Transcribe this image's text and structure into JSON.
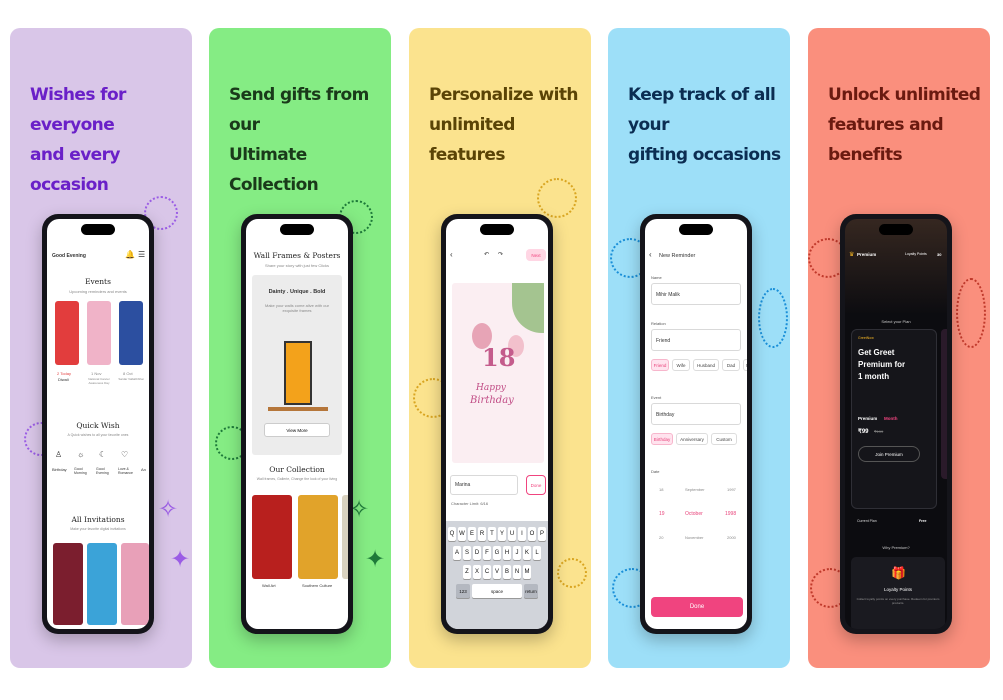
{
  "colors": {
    "card1": "#d9c6e8",
    "card2": "#85ec84",
    "card3": "#fbe38e",
    "card4": "#9ddff8",
    "card5": "#fa8f7d",
    "accent_pink": "#f0447f",
    "premium_gold": "#f5b625"
  },
  "cards": [
    {
      "headline_1": "Wishes for everyone",
      "headline_2": "and every occasion",
      "screen": {
        "greeting": "Good Evening",
        "events_title": "Events",
        "events_sub": "Upcoming reminders and events",
        "event_tiles": [
          {
            "when": "2 Today",
            "name": "Diwali"
          },
          {
            "when": "1 Nov",
            "name": "National Cancer Awareness Day"
          },
          {
            "when": "8 Oct",
            "name": "Sardar Vallabhbhai"
          }
        ],
        "quick_wish_title": "Quick Wish",
        "quick_wish_sub": "A Quick wishes to all your favorite ones",
        "quick_items": [
          "Birthday",
          "Good Morning",
          "Good Evening",
          "Love & Romance",
          "An"
        ],
        "invitations_title": "All Invitations",
        "invitations_sub": "Make your favorite digital invitations"
      }
    },
    {
      "headline_1": "Send gifts from our",
      "headline_2": "Ultimate Collection",
      "screen": {
        "title": "Wall Frames & Posters",
        "subtitle": "Share your story with just few Clicks",
        "banner_title": "Dainty . Unique . Bold",
        "banner_text": "Make your walls come alive with our exquisite frames",
        "view_more": "View More",
        "collection_title": "Our Collection",
        "collection_sub": "Wall frames, Gallerie, Change the look of your living",
        "items": [
          "Wall Art",
          "Southern Culture"
        ]
      }
    },
    {
      "headline_1": "Personalize with",
      "headline_2": "unlimited features",
      "screen": {
        "next": "Next",
        "card_number": "18",
        "card_text_1": "Happy",
        "card_text_2": "Birthday",
        "input_value": "Marina",
        "done": "Done",
        "char_limit": "Character Limit: 6/16",
        "kb_row1": [
          "Q",
          "W",
          "E",
          "R",
          "T",
          "Y",
          "U",
          "I",
          "O",
          "P"
        ],
        "kb_row2": [
          "A",
          "S",
          "D",
          "F",
          "G",
          "H",
          "J",
          "K",
          "L"
        ],
        "kb_row3": [
          "Z",
          "X",
          "C",
          "V",
          "B",
          "N",
          "M"
        ],
        "kb_num": "123",
        "kb_space": "space",
        "kb_return": "return"
      }
    },
    {
      "headline_1": "Keep track of all your",
      "headline_2": "gifting occasions",
      "screen": {
        "title": "New Reminder",
        "name_label": "Name",
        "name_value": "Mihir Malik",
        "relation_label": "Relation",
        "relation_value": "Friend",
        "relation_chips": [
          "Friend",
          "Wife",
          "Husband",
          "Dad",
          "M"
        ],
        "event_label": "Event",
        "event_value": "Birthday",
        "event_chips": [
          "Birthday",
          "Anniversary",
          "Custom"
        ],
        "date_label": "Date",
        "date_rows": [
          {
            "d": "18",
            "m": "September",
            "y": "1997"
          },
          {
            "d": "19",
            "m": "October",
            "y": "1998"
          },
          {
            "d": "20",
            "m": "November",
            "y": "2000"
          }
        ],
        "done": "Done"
      }
    },
    {
      "headline_1": "Unlock unlimited",
      "headline_2": "features and benefits",
      "screen": {
        "brand": "Premium",
        "loyalty_label": "Loyalty Points",
        "loyalty_value": "30",
        "select_plan": "Select your Plan",
        "plan_brand": "GreetNow",
        "plan_title_1": "Get Greet",
        "plan_title_2": "Premium for",
        "plan_title_3": "1 month",
        "price_label": "Premium",
        "price_period": "Month",
        "price": "₹99",
        "price_old": "₹199",
        "join": "Join Premium",
        "current_plan": "Current Plan",
        "current_value": "Free",
        "why": "Why Premium?",
        "benefit_title": "Loyalty Points",
        "benefit_text": "Collect loyalty points on every purchase. Redeem for premium products."
      }
    }
  ]
}
